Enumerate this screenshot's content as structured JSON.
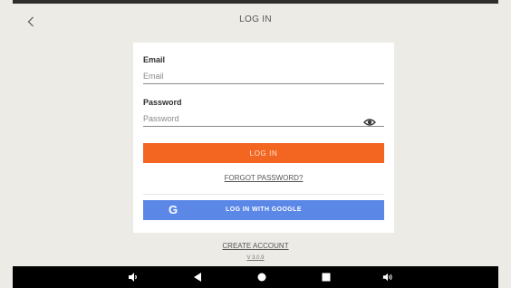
{
  "header": {
    "title": "LOG IN",
    "back_icon": "chevron-left-icon"
  },
  "form": {
    "email_label": "Email",
    "email_placeholder": "Email",
    "password_label": "Password",
    "password_placeholder": "Password",
    "show_password_icon": "eye-icon",
    "login_label": "LOG IN",
    "forgot_label": "FORGOT PASSWORD?",
    "google_label": "LOG IN WITH GOOGLE",
    "google_icon": "google-g-icon"
  },
  "footer": {
    "create_account_label": "CREATE ACCOUNT",
    "version": "V 3.0.9"
  },
  "navbar": {
    "icons": [
      "volume-down-icon",
      "back-triangle-icon",
      "home-circle-icon",
      "recents-square-icon",
      "volume-up-icon"
    ]
  },
  "colors": {
    "background": "#edebe6",
    "primary": "#f26622",
    "google": "#5b87e6",
    "card": "#ffffff",
    "navbar": "#000000"
  }
}
